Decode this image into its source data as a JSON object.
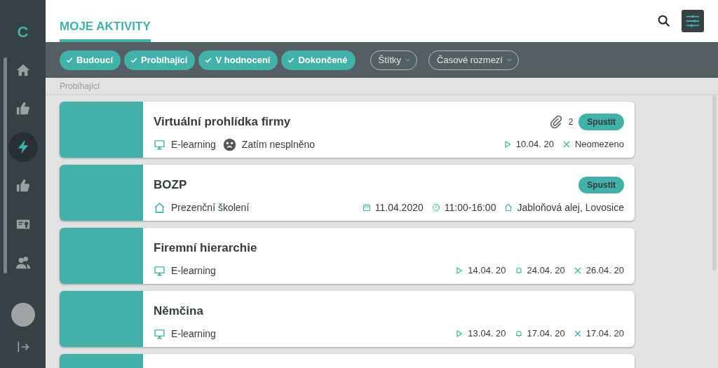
{
  "sidebar": {
    "logo": "C",
    "items": [
      {
        "kind": "home",
        "selected": false
      },
      {
        "kind": "thumb",
        "selected": false
      },
      {
        "kind": "bolt",
        "selected": true
      },
      {
        "kind": "thumb",
        "selected": false
      },
      {
        "kind": "certificate",
        "selected": false
      },
      {
        "kind": "people",
        "selected": false
      }
    ]
  },
  "header": {
    "tabs": [
      {
        "label": "MOJE AKTIVITY",
        "selected": true
      }
    ]
  },
  "filters": [
    {
      "label": "Budoucí",
      "checked": true
    },
    {
      "label": "Probíhající",
      "checked": true
    },
    {
      "label": "V hodnocení",
      "checked": true
    },
    {
      "label": "Dokončené",
      "checked": true
    }
  ],
  "dropdowns": [
    "Štítky",
    "Časové rozmezí"
  ],
  "section_label": "Probíhající",
  "activities": [
    {
      "title": "Virtuální prohlídka firmy",
      "type": {
        "kind": "monitor",
        "label": "E-learning"
      },
      "status": "Zatím nesplněno",
      "attachments": "2",
      "action": "Spustit",
      "meta": [
        {
          "kind": "play",
          "text": "10.04. 20"
        },
        {
          "kind": "cross",
          "text": "Neomezeno"
        }
      ]
    },
    {
      "title": "BOZP",
      "type": {
        "kind": "home",
        "label": "Prezenční školení"
      },
      "action": "Spustit",
      "meta": [
        {
          "kind": "calendar",
          "text": "11.04.2020"
        },
        {
          "kind": "clock",
          "text": "11:00-16:00"
        },
        {
          "kind": "home",
          "text": "Jabloňová alej, Lovosice"
        }
      ]
    },
    {
      "title": "Firemní hierarchie",
      "type": {
        "kind": "monitor",
        "label": "E-learning"
      },
      "meta": [
        {
          "kind": "play",
          "text": "14.04. 20"
        },
        {
          "kind": "bell",
          "text": "24.04. 20"
        },
        {
          "kind": "cross",
          "text": "26.04. 20"
        }
      ]
    },
    {
      "title": "Němčina",
      "type": {
        "kind": "monitor",
        "label": "E-learning"
      },
      "meta": [
        {
          "kind": "play",
          "text": "13.04. 20"
        },
        {
          "kind": "bell",
          "text": "17.04. 20"
        },
        {
          "kind": "cross",
          "text": "17.04. 20"
        }
      ]
    }
  ],
  "more_below": true
}
